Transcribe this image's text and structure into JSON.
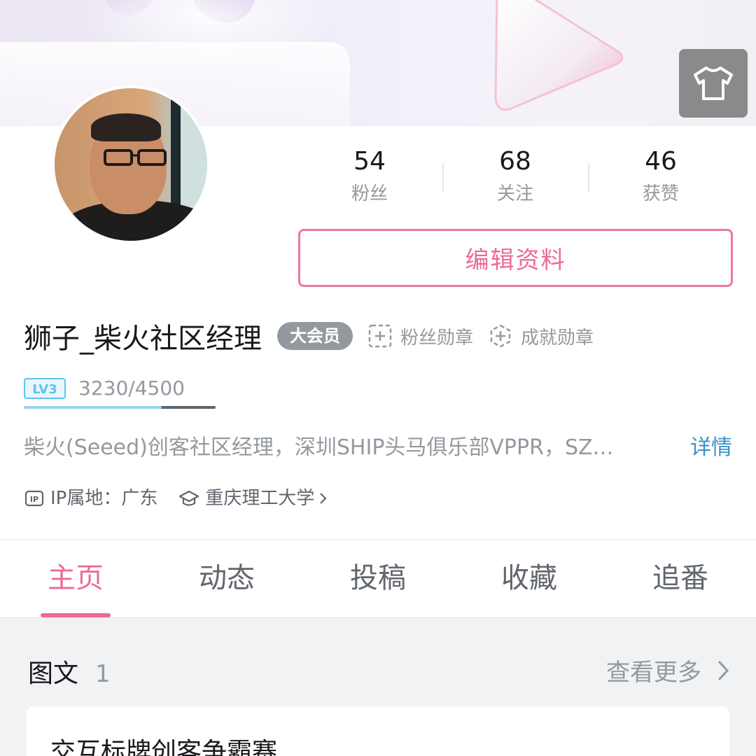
{
  "header": {
    "skin_icon": "tshirt-icon"
  },
  "profile": {
    "avatar_icon": "user-avatar",
    "stats": [
      {
        "value": "54",
        "label": "粉丝"
      },
      {
        "value": "68",
        "label": "关注"
      },
      {
        "value": "46",
        "label": "获赞"
      }
    ],
    "edit_label": "编辑资料",
    "name": "狮子_柴火社区经理",
    "vip_label": "大会员",
    "fans_medal_label": "粉丝勋章",
    "achievement_medal_label": "成就勋章",
    "level": {
      "badge": "LV3",
      "progress_text": "3230/4500",
      "progress_fraction": 0.7178
    },
    "bio": "柴火(Seeed)创客社区经理，深圳SHIP头马俱乐部VPPR，SZ…",
    "detail_label": "详情",
    "ip_label": "IP属地：广东",
    "school_label": "重庆理工大学"
  },
  "tabs": [
    {
      "label": "主页",
      "active": true
    },
    {
      "label": "动态",
      "active": false
    },
    {
      "label": "投稿",
      "active": false
    },
    {
      "label": "收藏",
      "active": false
    },
    {
      "label": "追番",
      "active": false
    }
  ],
  "section": {
    "title": "图文",
    "count": "1",
    "more_label": "查看更多"
  },
  "card": {
    "title": "交互标牌创客争霸赛"
  },
  "colors": {
    "accent": "#ec6b92",
    "link": "#3a90c9",
    "muted": "#9499a0",
    "level_fill": "#9ad1f0"
  }
}
